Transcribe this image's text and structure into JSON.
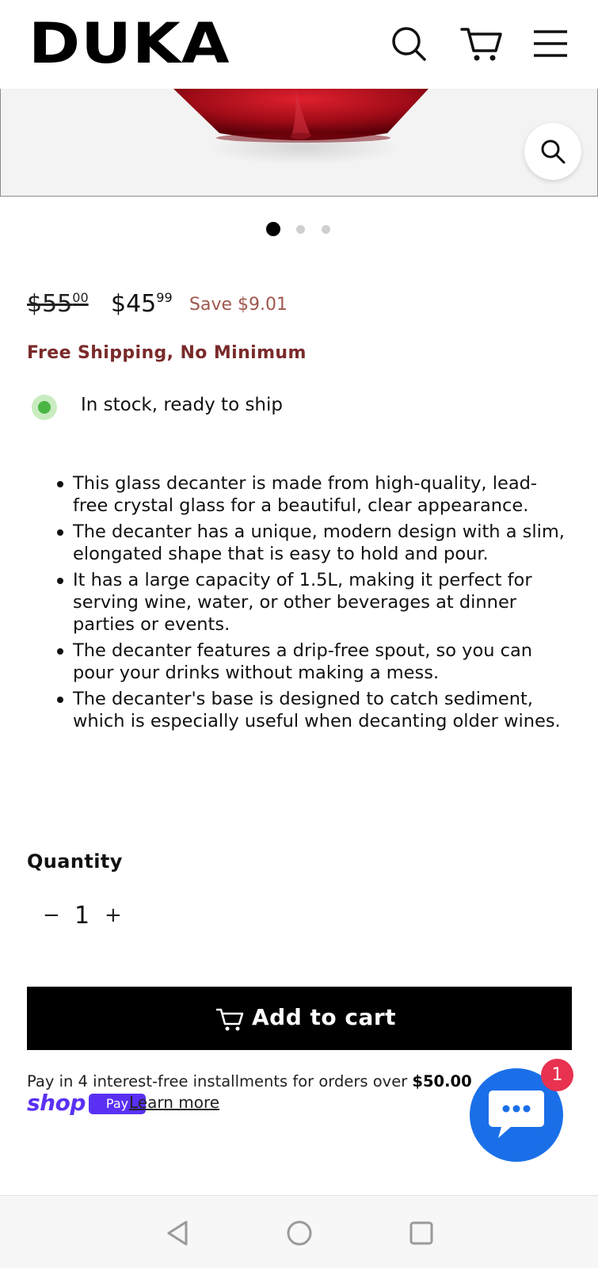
{
  "header": {
    "logo": "DUKA",
    "icons": [
      "search-icon",
      "cart-icon",
      "menu-icon"
    ]
  },
  "gallery": {
    "slide_count": 3,
    "active_slide": 1,
    "zoom_icon": "zoom-icon"
  },
  "pricing": {
    "original_price": "$55",
    "original_cents": "00",
    "sale_price": "$45",
    "sale_cents": "99",
    "savings": "Save $9.01"
  },
  "shipping": "Free Shipping, No Minimum",
  "stock": {
    "status": "In stock, ready to ship",
    "color": "#4ab545"
  },
  "description": [
    "This glass decanter is made from high-quality, lead-free crystal glass for a beautiful, clear appearance.",
    "The decanter has a unique, modern design with a slim, elongated shape that is easy to hold and pour.",
    "It has a large capacity of 1.5L, making it perfect for serving wine, water, or other beverages at dinner parties or events.",
    "The decanter features a drip-free spout, so you can pour your drinks without making a mess.",
    "The decanter's base is designed to catch sediment, which is especially useful when decanting older wines."
  ],
  "quantity": {
    "label": "Quantity",
    "minus": "−",
    "value": "1",
    "plus": "+"
  },
  "cart": {
    "add_label": "Add to cart"
  },
  "installments": {
    "text": "Pay in 4 interest-free installments for orders over ",
    "threshold": "$50.00",
    "shop_word": "shop",
    "pay_badge": "Pay",
    "learn_more": "Learn more"
  },
  "chat": {
    "badge_count": "1",
    "color": "#1a6fe8"
  },
  "colors": {
    "shipping": "#7a2a2a",
    "savings": "#a0574e",
    "shop_pay": "#5a31f4",
    "badge": "#e8324f"
  }
}
